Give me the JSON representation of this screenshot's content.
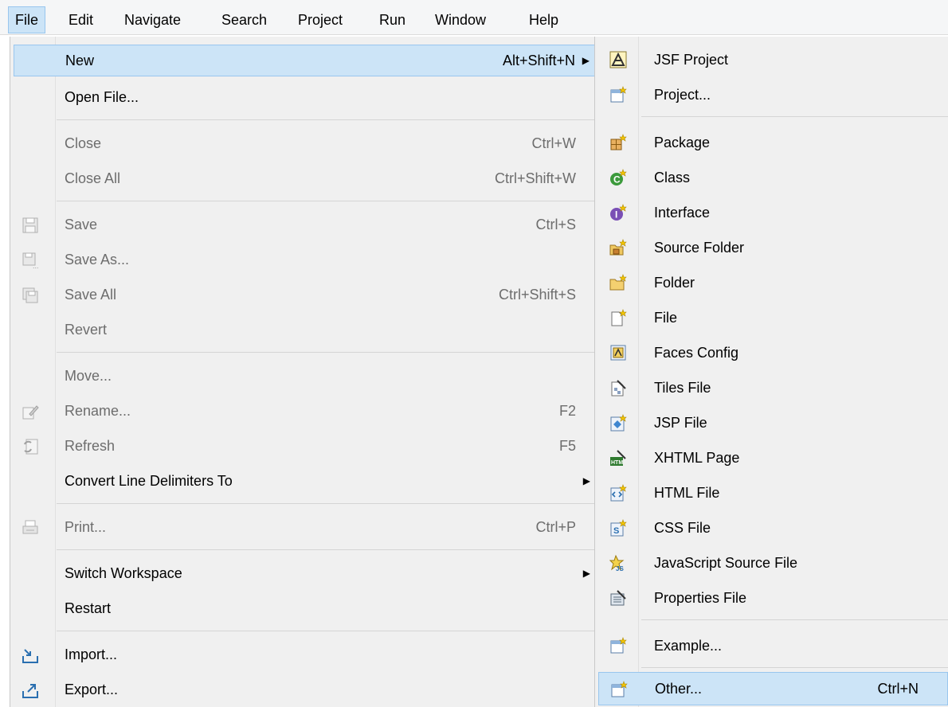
{
  "menubar": {
    "items": [
      "File",
      "Edit",
      "Navigate",
      "Search",
      "Project",
      "Run",
      "Window",
      "Help"
    ]
  },
  "file_menu": {
    "new": {
      "label": "New",
      "accel": "Alt+Shift+N"
    },
    "open_file": {
      "label": "Open File..."
    },
    "close": {
      "label": "Close",
      "accel": "Ctrl+W"
    },
    "close_all": {
      "label": "Close All",
      "accel": "Ctrl+Shift+W"
    },
    "save": {
      "label": "Save",
      "accel": "Ctrl+S"
    },
    "save_as": {
      "label": "Save As..."
    },
    "save_all": {
      "label": "Save All",
      "accel": "Ctrl+Shift+S"
    },
    "revert": {
      "label": "Revert"
    },
    "move": {
      "label": "Move..."
    },
    "rename": {
      "label": "Rename...",
      "accel": "F2"
    },
    "refresh": {
      "label": "Refresh",
      "accel": "F5"
    },
    "convert": {
      "label": "Convert Line Delimiters To"
    },
    "print": {
      "label": "Print...",
      "accel": "Ctrl+P"
    },
    "switch_workspace": {
      "label": "Switch Workspace"
    },
    "restart": {
      "label": "Restart"
    },
    "import": {
      "label": "Import..."
    },
    "export": {
      "label": "Export..."
    }
  },
  "new_submenu": {
    "jsf_project": "JSF Project",
    "project": "Project...",
    "package": "Package",
    "class": "Class",
    "interface": "Interface",
    "source_folder": "Source Folder",
    "folder": "Folder",
    "file": "File",
    "faces_config": "Faces Config",
    "tiles_file": "Tiles File",
    "jsp_file": "JSP File",
    "xhtml_page": "XHTML Page",
    "html_file": "HTML File",
    "css_file": "CSS File",
    "js_source_file": "JavaScript Source File",
    "properties_file": "Properties File",
    "example": "Example...",
    "other": {
      "label": "Other...",
      "accel": "Ctrl+N"
    }
  },
  "colors": {
    "highlight": "#cce4f7",
    "highlight_border": "#99c6ee",
    "menu_bg": "#f0f0f0",
    "disabled_text": "#6d6d6d"
  }
}
